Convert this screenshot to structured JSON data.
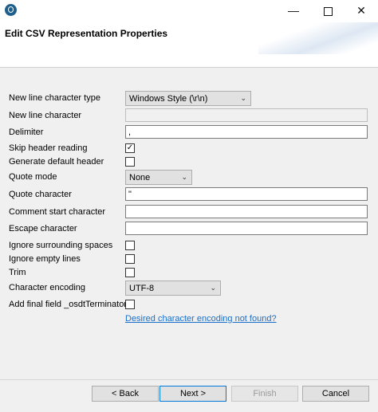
{
  "window": {
    "controls": {
      "minimize": "—",
      "close": "✕"
    }
  },
  "dialog": {
    "title": "Edit CSV Representation Properties"
  },
  "form": {
    "new_line_type": {
      "label": "New line character type",
      "value": "Windows Style (\\r\\n)"
    },
    "new_line_char": {
      "label": "New line character",
      "value": ""
    },
    "delimiter": {
      "label": "Delimiter",
      "value": ","
    },
    "skip_header": {
      "label": "Skip header reading",
      "checked": "✓"
    },
    "generate_header": {
      "label": "Generate default header",
      "checked": ""
    },
    "quote_mode": {
      "label": "Quote mode",
      "value": "None"
    },
    "quote_char": {
      "label": "Quote character",
      "value": "\""
    },
    "comment_start": {
      "label": "Comment start character",
      "value": ""
    },
    "escape_char": {
      "label": "Escape character",
      "value": ""
    },
    "ignore_spaces": {
      "label": "Ignore surrounding spaces",
      "checked": ""
    },
    "ignore_empty": {
      "label": "Ignore empty lines",
      "checked": ""
    },
    "trim": {
      "label": "Trim",
      "checked": ""
    },
    "encoding": {
      "label": "Character encoding",
      "value": "UTF-8"
    },
    "final_field": {
      "label": "Add final field _osdtTerminator",
      "checked": ""
    },
    "encoding_link": "Desired character encoding not found?"
  },
  "buttons": {
    "back": "< Back",
    "next": "Next >",
    "finish": "Finish",
    "cancel": "Cancel"
  },
  "icons": {
    "app": "talend-app-icon",
    "dropdown": "chevron-down-icon",
    "check": "checkmark-icon"
  }
}
